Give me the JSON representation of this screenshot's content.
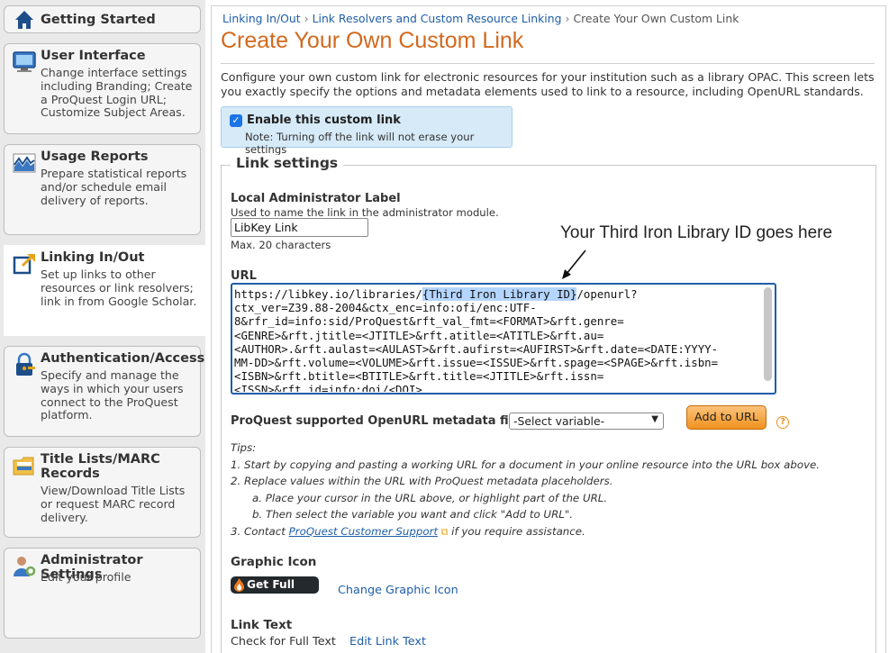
{
  "sidebar": {
    "items": [
      {
        "title": "Getting Started",
        "desc": "",
        "icon": "home-icon"
      },
      {
        "title": "User Interface",
        "desc": "Change interface settings including Branding; Create a ProQuest Login URL; Customize Subject Areas.",
        "icon": "monitor-icon"
      },
      {
        "title": "Usage Reports",
        "desc": "Prepare statistical reports and/or schedule email delivery of reports.",
        "icon": "chart-icon"
      },
      {
        "title": "Linking In/Out",
        "desc": "Set up links to other resources or link resolvers; link in from Google Scholar.",
        "icon": "link-out-icon"
      },
      {
        "title": "Authentication/Access",
        "desc": "Specify and manage the ways in which your users connect to the ProQuest platform.",
        "icon": "lock-icon"
      },
      {
        "title": "Title Lists/MARC Records",
        "desc": "View/Download Title Lists or request MARC record delivery.",
        "icon": "folder-icon"
      },
      {
        "title": "Administrator Settings",
        "desc": "Edit your profile",
        "icon": "user-icon"
      }
    ]
  },
  "breadcrumb": {
    "c1": "Linking In/Out",
    "c2": "Link Resolvers and Custom Resource Linking",
    "c3": "Create Your Own Custom Link",
    "sep": "›"
  },
  "page": {
    "title": "Create Your Own Custom Link",
    "intro": "Configure your own custom link for electronic resources for your institution such as a library OPAC. This screen lets you exactly specify the options and metadata elements used to link to a resource, including OpenURL standards.",
    "enable_label": "Enable this custom link",
    "enable_note": "Note: Turning off the link will not erase your settings",
    "enable_checked": true
  },
  "settings": {
    "legend": "Link settings",
    "admin_label": "Local Administrator Label",
    "admin_help": "Used to name the link in the administrator module.",
    "admin_value": "LibKey Link",
    "admin_max": "Max. 20 characters",
    "annotation": "Your Third Iron Library ID goes here",
    "url_label": "URL",
    "url_pre": "https://libkey.io/libraries/",
    "url_highlight": "{Third Iron Library ID}",
    "url_post": "/openurl?",
    "url_lines": [
      "ctx_ver=Z39.88-2004&ctx_enc=info:ofi/enc:UTF-",
      "8&rfr_id=info:sid/ProQuest&rft_val_fmt=<FORMAT>&rft.genre=",
      "<GENRE>&rft.jtitle=<JTITLE>&rft.atitle=<ATITLE>&rft.au=",
      "<AUTHOR>.&rft.aulast=<AULAST>&rft.aufirst=<AUFIRST>&rft.date=<DATE:YYYY-",
      "MM-DD>&rft.volume=<VOLUME>&rft.issue=<ISSUE>&rft.spage=<SPAGE>&rft.isbn=",
      "<ISBN>&rft.btitle=<BTITLE>&rft.title=<JTITLE>&rft.issn=",
      "<ISSN>&rft_id=info:doi/<DOI>"
    ],
    "metadata_label": "ProQuest supported OpenURL metadata fields",
    "metadata_selected": "-Select variable-",
    "add_button": "Add to URL",
    "help_glyph": "?",
    "tips_title": "Tips:",
    "tip1": "1. Start by copying and pasting a working URL for a document in your online resource into the URL box above.",
    "tip2": "2. Replace values within the URL with ProQuest metadata placeholders.",
    "tip2a": "a. Place your cursor in the URL above, or highlight part of the URL.",
    "tip2b": "b. Then select the variable you want and click \"Add to URL\".",
    "tip3_pre": "3. Contact ",
    "tip3_link": "ProQuest Customer Support",
    "tip3_post": " if you require assistance.",
    "graphic_icon_label": "Graphic Icon",
    "badge_text": "Get Full Text",
    "change_icon": "Change Graphic Icon",
    "link_text_label": "Link Text",
    "link_text_value": "Check for Full Text",
    "edit_link_text": "Edit Link Text"
  },
  "colors": {
    "accent": "#d2691e",
    "link": "#1f5ea8",
    "button": "#f0921e",
    "enable_bg": "#d6eaf8"
  }
}
